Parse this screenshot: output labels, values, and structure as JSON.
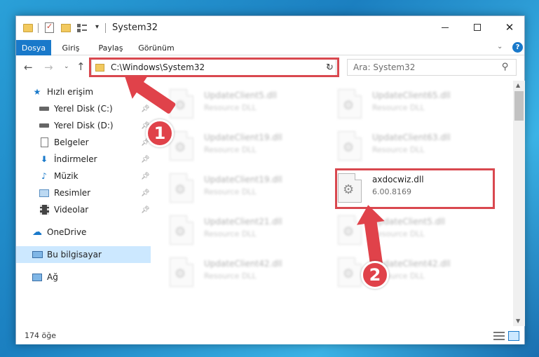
{
  "window": {
    "title": "System32"
  },
  "ribbon": {
    "tabs": [
      "Dosya",
      "Giriş",
      "Paylaş",
      "Görünüm"
    ],
    "help": "?"
  },
  "nav": {
    "address": "C:\\Windows\\System32",
    "search_placeholder": "Ara: System32"
  },
  "sidebar": {
    "items": [
      {
        "label": "Hızlı erişim",
        "icon": "star-icon"
      },
      {
        "label": "Yerel Disk (C:)",
        "icon": "drive-icon",
        "pinned": true
      },
      {
        "label": "Yerel Disk (D:)",
        "icon": "drive-icon",
        "pinned": true
      },
      {
        "label": "Belgeler",
        "icon": "documents-icon",
        "pinned": true
      },
      {
        "label": "İndirmeler",
        "icon": "download-icon",
        "pinned": true
      },
      {
        "label": "Müzik",
        "icon": "music-icon",
        "pinned": true
      },
      {
        "label": "Resimler",
        "icon": "pictures-icon",
        "pinned": true
      },
      {
        "label": "Videolar",
        "icon": "videos-icon",
        "pinned": true
      },
      {
        "label": "OneDrive",
        "icon": "cloud-icon"
      },
      {
        "label": "Bu bilgisayar",
        "icon": "computer-icon",
        "selected": true
      },
      {
        "label": "Ağ",
        "icon": "network-icon"
      }
    ]
  },
  "files": {
    "left": [
      {
        "name": "UpdateClient5.dll",
        "type": "Resource DLL"
      },
      {
        "name": "UpdateClient19.dll",
        "type": "Resource DLL"
      },
      {
        "name": "UpdateClient19.dll",
        "type": "Resource DLL"
      },
      {
        "name": "UpdateClient21.dll",
        "type": "Resource DLL"
      },
      {
        "name": "UpdateClient42.dll",
        "type": "Resource DLL"
      }
    ],
    "right": [
      {
        "name": "UpdateClient65.dll",
        "type": "Resource DLL"
      },
      {
        "name": "UpdateClient63.dll",
        "type": "Resource DLL"
      },
      {
        "name": "axdocwiz.dll",
        "type": "6.00.8169"
      },
      {
        "name": "UpdateClient5.dll",
        "type": "Resource DLL"
      },
      {
        "name": "UpdateClient42.dll",
        "type": "Resource DLL"
      }
    ]
  },
  "status": {
    "count": "174 öğe"
  },
  "annotations": {
    "badge1": "1",
    "badge2": "2"
  },
  "colors": {
    "accent": "#1979ca",
    "highlight": "#d9484f",
    "selected": "#cce8ff"
  }
}
